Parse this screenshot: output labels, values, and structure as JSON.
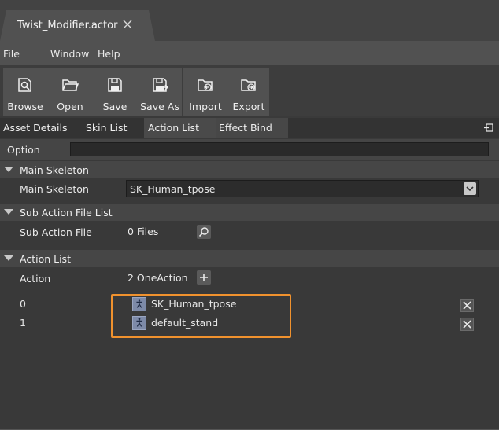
{
  "document_tab": {
    "title": "Twist_Modifier.actor"
  },
  "menu": {
    "items": [
      "File",
      "Window",
      "Help"
    ]
  },
  "toolbar": {
    "browse": "Browse",
    "open": "Open",
    "save": "Save",
    "save_as": "Save As",
    "import": "Import",
    "export": "Export"
  },
  "panel_tabs": [
    "Asset Details",
    "Skin List",
    "Action List",
    "Effect Bind"
  ],
  "option": {
    "label": "Option",
    "value": ""
  },
  "main_skeleton": {
    "header": "Main Skeleton",
    "label": "Main Skeleton",
    "value": "SK_Human_tpose"
  },
  "sub_action": {
    "header": "Sub Action File List",
    "label": "Sub Action File",
    "value": "0 Files"
  },
  "action_list": {
    "header": "Action List",
    "label": "Action",
    "value": "2 OneAction",
    "items": [
      {
        "index": "0",
        "name": "SK_Human_tpose"
      },
      {
        "index": "1",
        "name": "default_stand"
      }
    ]
  },
  "colors": {
    "highlight": "#f0922e",
    "active_tab": "#4a4a4a"
  }
}
